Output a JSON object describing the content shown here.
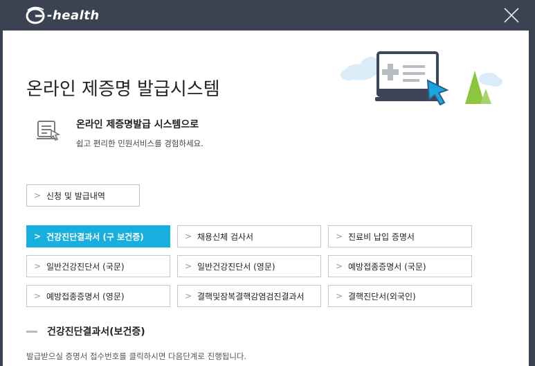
{
  "app": {
    "logo_text": "-health",
    "close_icon": "close-x-icon"
  },
  "page": {
    "title": "온라인 제증명 발급시스템",
    "intro_heading": "온라인 제증명발급 시스템으로",
    "intro_sub": "쉽고 편리한 민원서비스를 경험하세요.",
    "history_button": "신청 및 발급내역",
    "section_title": "건강진단결과서(보건증)",
    "note": "발급받으실 증명서 접수번호를 클릭하시면 다음단계로 진행됩니다."
  },
  "certificates": [
    {
      "label": "건강진단결과서 (구 보건증)",
      "active": true
    },
    {
      "label": "채용신체 검사서",
      "active": false
    },
    {
      "label": "진료비 납입 증명서",
      "active": false
    },
    {
      "label": "일반건강진단서 (국문)",
      "active": false
    },
    {
      "label": "일반건강진단서 (영문)",
      "active": false
    },
    {
      "label": "예방접종증명서 (국문)",
      "active": false
    },
    {
      "label": "예방접종증명서 (영문)",
      "active": false
    },
    {
      "label": "결핵및잠복결핵감염검진결과서",
      "active": false
    },
    {
      "label": "결핵진단서(외국인)",
      "active": false
    }
  ],
  "colors": {
    "titlebar": "#3b4352",
    "accent": "#17aee0",
    "text": "#222222"
  }
}
